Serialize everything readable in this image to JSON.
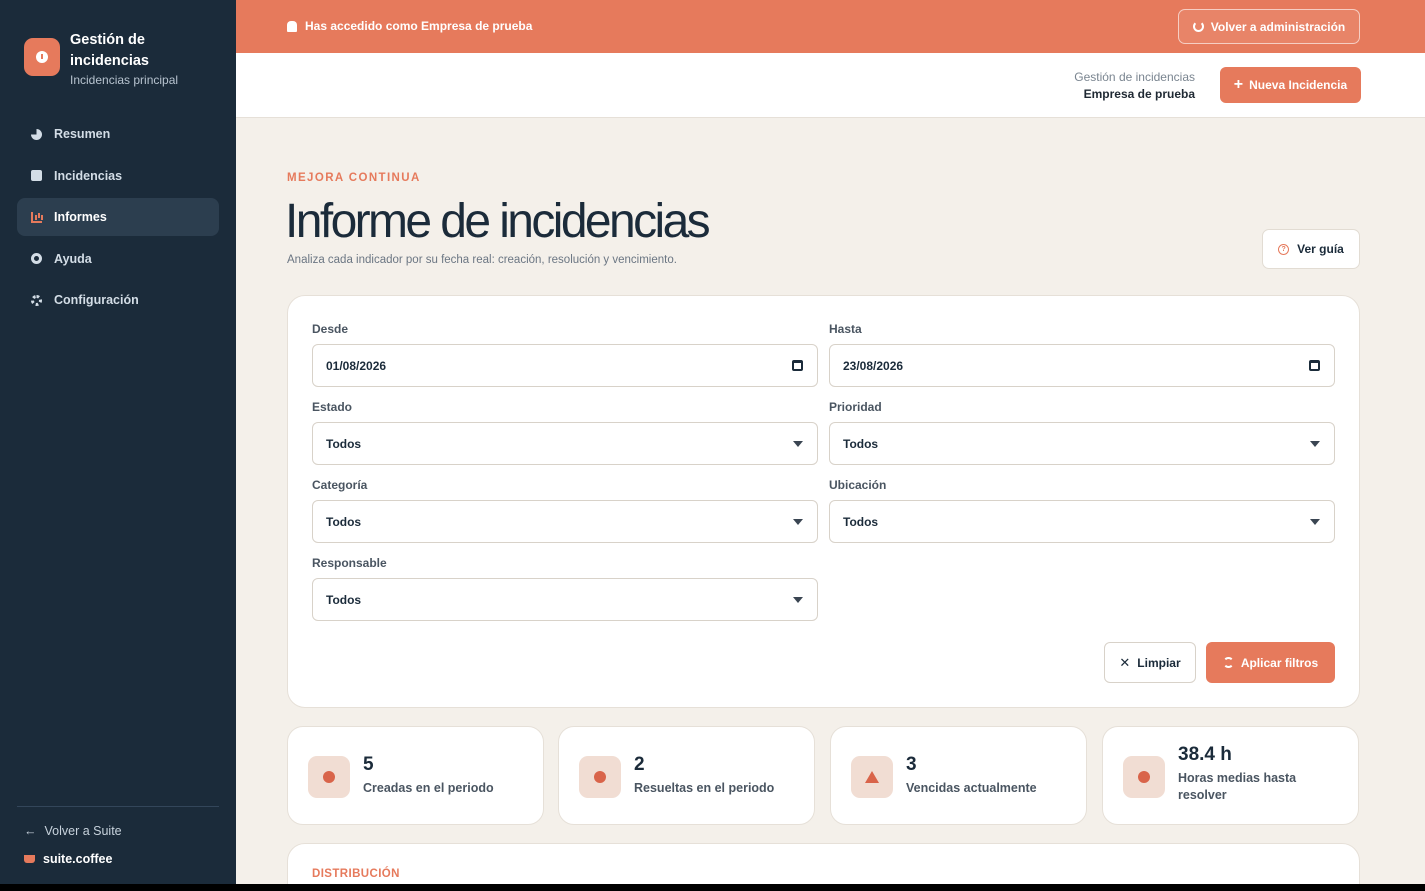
{
  "sidebar": {
    "brand_title": "Gestión de incidencias",
    "brand_subtitle": "Incidencias principal",
    "items": [
      {
        "label": "Resumen",
        "icon": "pie-chart-icon"
      },
      {
        "label": "Incidencias",
        "icon": "clipboard-icon"
      },
      {
        "label": "Informes",
        "icon": "bar-chart-icon",
        "active": true
      },
      {
        "label": "Ayuda",
        "icon": "help-icon"
      },
      {
        "label": "Configuración",
        "icon": "gear-icon"
      }
    ],
    "back_label": "Volver a Suite",
    "suite_label": "suite.coffee"
  },
  "banner": {
    "text": "Has accedido como Empresa de prueba",
    "back_button": "Volver a administración"
  },
  "header": {
    "context_line1": "Gestión de incidencias",
    "context_line2": "Empresa de prueba",
    "new_button": "Nueva Incidencia"
  },
  "page": {
    "eyebrow": "MEJORA CONTINUA",
    "title": "Informe de incidencias",
    "description": "Analiza cada indicador por su fecha real: creación, resolución y vencimiento.",
    "guide_button": "Ver guía"
  },
  "filters": {
    "desde_label": "Desde",
    "desde_value": "01/08/2026",
    "hasta_label": "Hasta",
    "hasta_value": "23/08/2026",
    "estado_label": "Estado",
    "estado_value": "Todos",
    "prioridad_label": "Prioridad",
    "prioridad_value": "Todos",
    "categoria_label": "Categoría",
    "categoria_value": "Todos",
    "ubicacion_label": "Ubicación",
    "ubicacion_value": "Todos",
    "responsable_label": "Responsable",
    "responsable_value": "Todos",
    "clear_button": "Limpiar",
    "apply_button": "Aplicar filtros"
  },
  "stats": [
    {
      "value": "5",
      "label": "Creadas en el periodo"
    },
    {
      "value": "2",
      "label": "Resueltas en el periodo"
    },
    {
      "value": "3",
      "label": "Vencidas actualmente"
    },
    {
      "value": "38.4 h",
      "label": "Horas medias hasta resolver"
    }
  ],
  "distribution": {
    "title": "DISTRIBUCIÓN"
  },
  "colors": {
    "accent": "#e67a5c",
    "sidebar": "#1b2b3a",
    "background": "#f4f0ea"
  }
}
